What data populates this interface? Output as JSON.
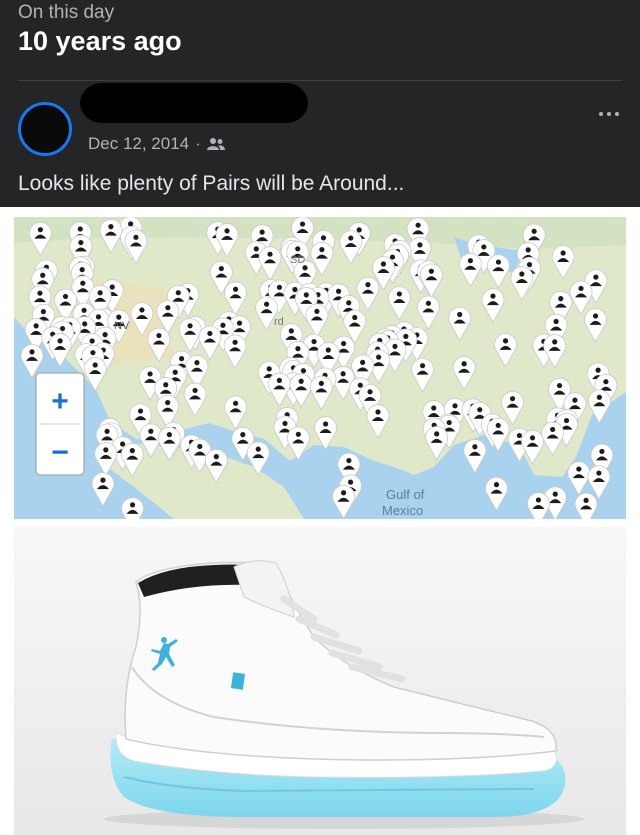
{
  "memory": {
    "label": "On this day",
    "years_ago": "10 years ago"
  },
  "post": {
    "date": "Dec 12, 2014",
    "separator": "·",
    "audience_icon": "friends-icon",
    "text": "Looks like plenty of Pairs will be Around...",
    "more_icon": "more-options-icon"
  },
  "map": {
    "labels": {
      "nv": "NV",
      "sd": "SD",
      "nd": "rd",
      "gulf_line1": "Gulf of",
      "gulf_line2": "Mexico"
    },
    "zoom_in": "+",
    "zoom_out": "−"
  },
  "colors": {
    "background": "#242526",
    "avatar_ring": "#1877f2",
    "shoe_accent": "#3bb3dd"
  }
}
